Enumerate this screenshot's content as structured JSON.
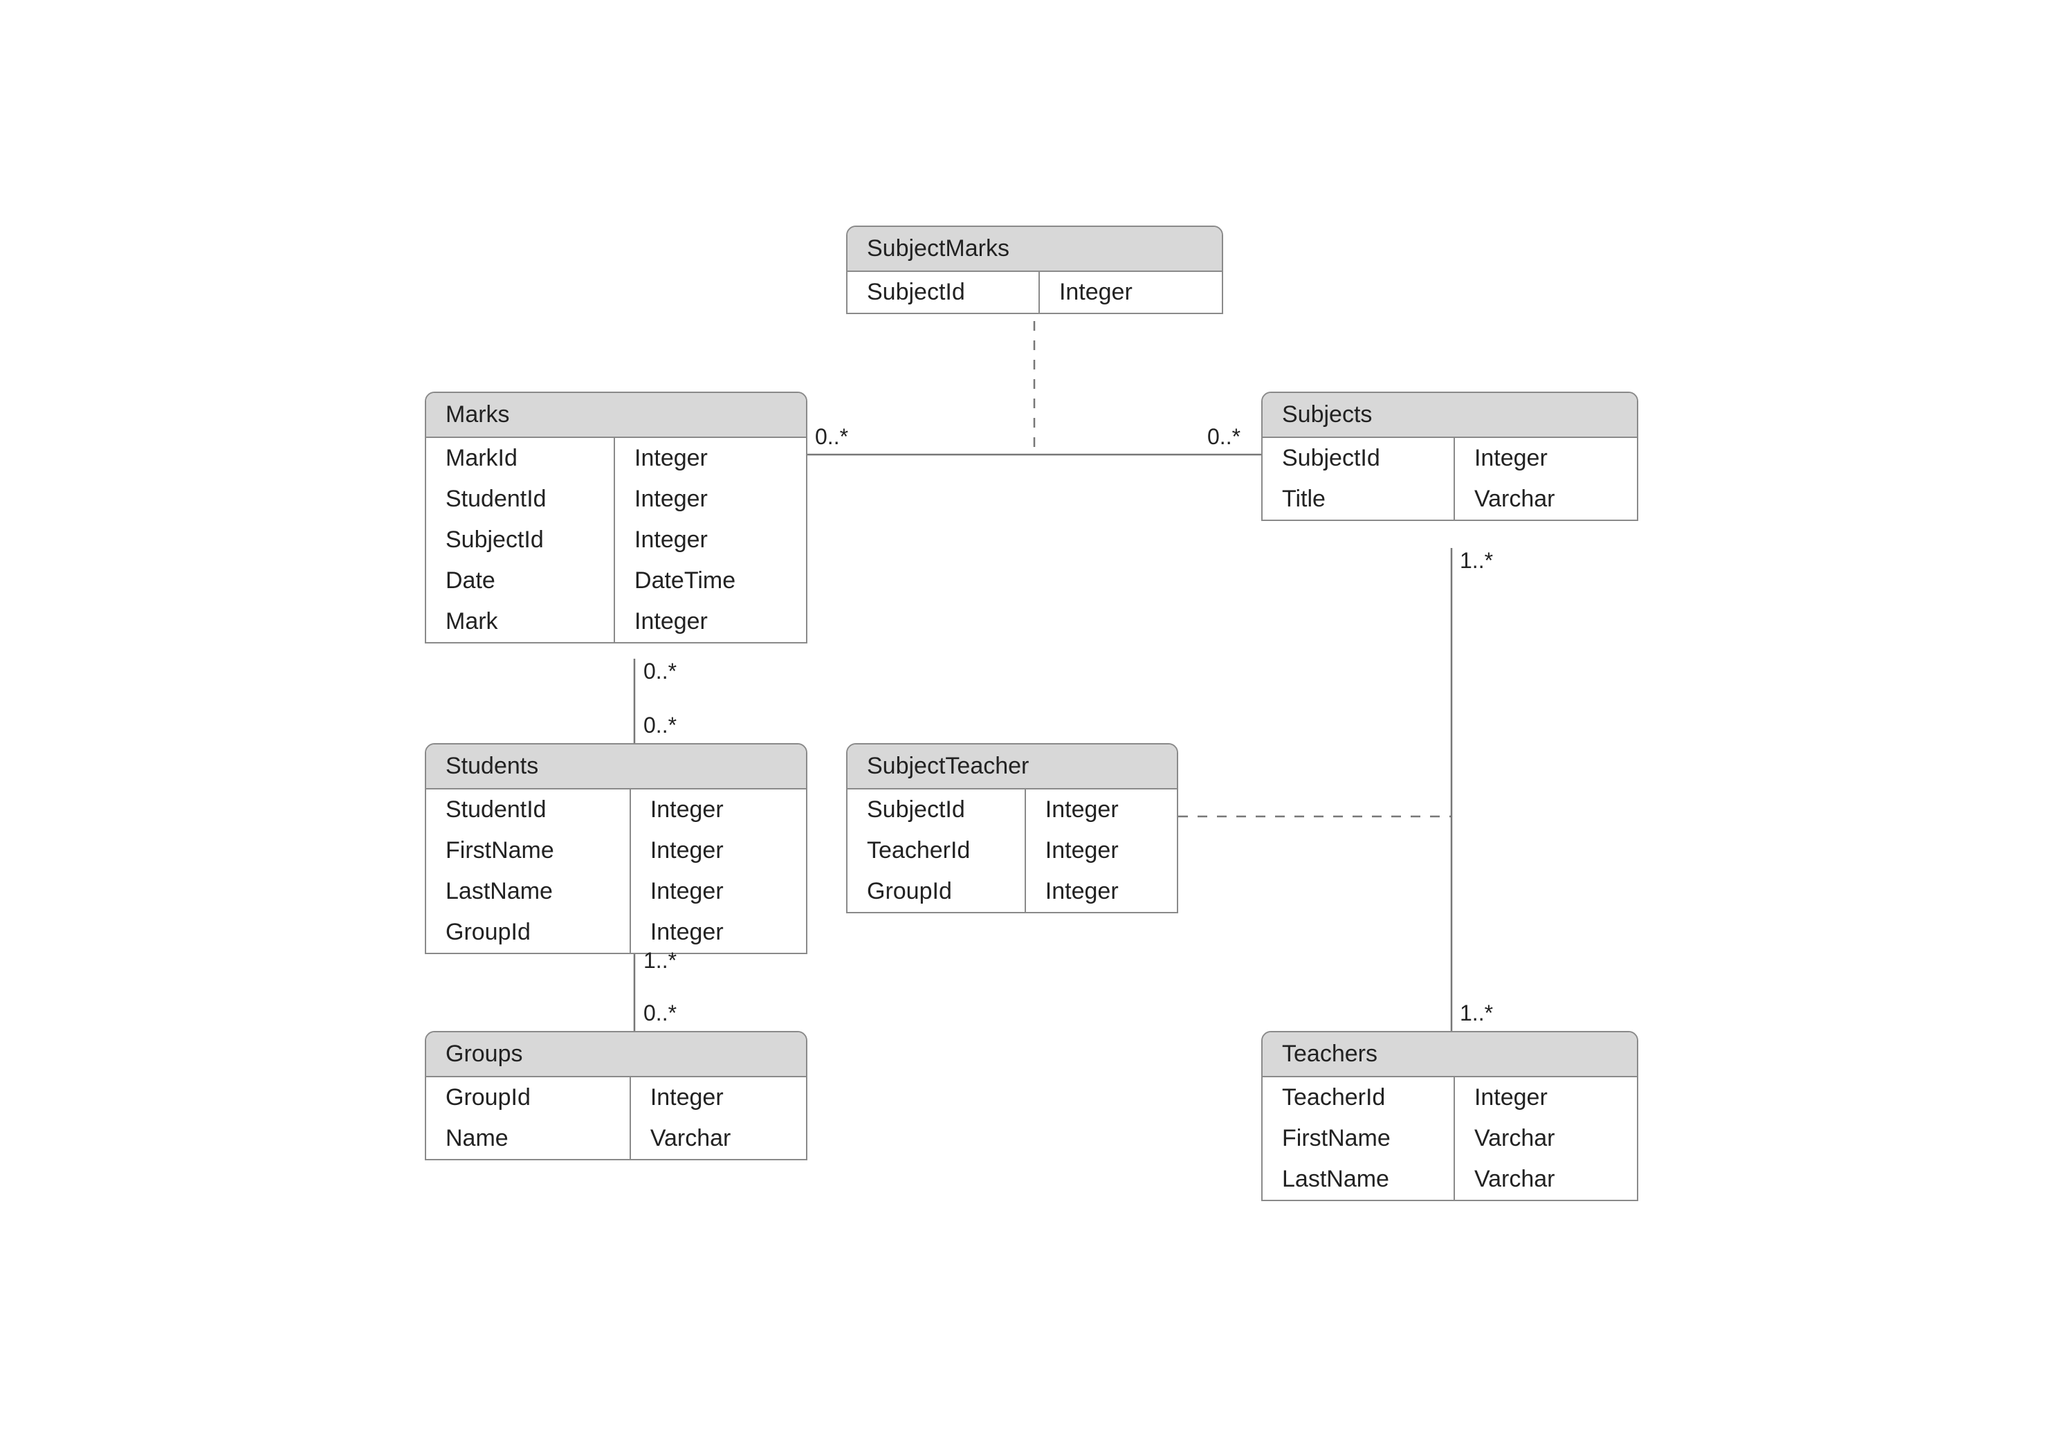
{
  "entities": {
    "subjectMarks": {
      "title": "SubjectMarks",
      "rows": [
        {
          "name": "SubjectId",
          "type": "Integer"
        }
      ]
    },
    "marks": {
      "title": "Marks",
      "rows": [
        {
          "name": "MarkId",
          "type": "Integer"
        },
        {
          "name": "StudentId",
          "type": "Integer"
        },
        {
          "name": "SubjectId",
          "type": "Integer"
        },
        {
          "name": "Date",
          "type": "DateTime"
        },
        {
          "name": "Mark",
          "type": "Integer"
        }
      ]
    },
    "subjects": {
      "title": "Subjects",
      "rows": [
        {
          "name": "SubjectId",
          "type": "Integer"
        },
        {
          "name": "Title",
          "type": "Varchar"
        }
      ]
    },
    "students": {
      "title": "Students",
      "rows": [
        {
          "name": "StudentId",
          "type": "Integer"
        },
        {
          "name": "FirstName",
          "type": "Integer"
        },
        {
          "name": "LastName",
          "type": "Integer"
        },
        {
          "name": "GroupId",
          "type": "Integer"
        }
      ]
    },
    "subjectTeacher": {
      "title": "SubjectTeacher",
      "rows": [
        {
          "name": "SubjectId",
          "type": "Integer"
        },
        {
          "name": "TeacherId",
          "type": "Integer"
        },
        {
          "name": "GroupId",
          "type": "Integer"
        }
      ]
    },
    "groups": {
      "title": "Groups",
      "rows": [
        {
          "name": "GroupId",
          "type": "Integer"
        },
        {
          "name": "Name",
          "type": "Varchar"
        }
      ]
    },
    "teachers": {
      "title": "Teachers",
      "rows": [
        {
          "name": "TeacherId",
          "type": "Integer"
        },
        {
          "name": "FirstName",
          "type": "Varchar"
        },
        {
          "name": "LastName",
          "type": "Varchar"
        }
      ]
    }
  },
  "multiplicities": {
    "marks_right": "0..*",
    "subjects_left": "0..*",
    "subjects_bottom": "1..*",
    "marks_bottom": "0..*",
    "students_top": "0..*",
    "students_bottom": "1..*",
    "groups_top": "0..*",
    "teachers_top": "1..*"
  }
}
